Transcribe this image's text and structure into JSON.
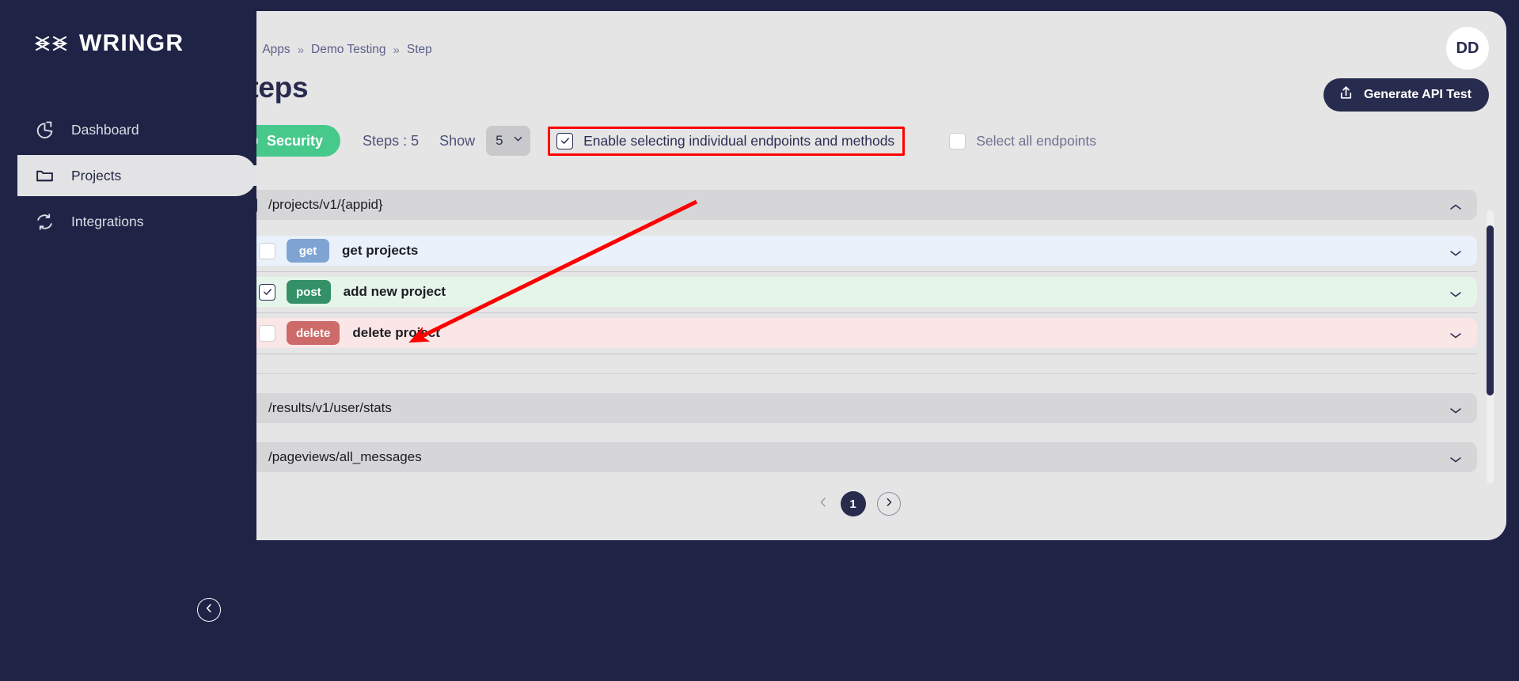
{
  "brand": {
    "name": "WRINGR",
    "logo_icon": "wringr-logo-icon"
  },
  "sidebar": {
    "items": [
      {
        "label": "Dashboard",
        "icon": "pie-chart-icon",
        "active": false
      },
      {
        "label": "Projects",
        "icon": "folder-icon",
        "active": true
      },
      {
        "label": "Integrations",
        "icon": "sync-refresh-icon",
        "active": false
      }
    ],
    "collapse_icon": "chevron-left-circle-icon"
  },
  "header": {
    "breadcrumb": {
      "home_icon": "home-icon",
      "separator": "»",
      "items": [
        "Apps",
        "Demo Testing",
        "Step"
      ]
    },
    "title": "Steps",
    "avatar_initials": "DD",
    "generate_button": {
      "label": "Generate API Test",
      "icon": "upload-share-icon"
    }
  },
  "toolbar": {
    "security_pill": {
      "label": "Security",
      "icon": "lock-icon",
      "color": "#48c98c"
    },
    "steps_count_label": "Steps : 5",
    "show_label": "Show",
    "show_select": {
      "value": "5",
      "icon": "chevron-down-icon"
    },
    "enable_individual": {
      "label": "Enable selecting individual endpoints and methods",
      "checked": true,
      "highlight_color": "#ff0000"
    },
    "select_all": {
      "label": "Select all endpoints",
      "checked": false
    }
  },
  "endpoints": [
    {
      "path": "/projects/v1/{appid}",
      "checked": true,
      "expanded": true,
      "chevron": "chevron-up-icon",
      "methods": [
        {
          "method": "get",
          "name": "get projects",
          "checked": false,
          "color": "#7fa4d3",
          "row_bg": "#eaf1fb",
          "chevron": "chevron-down-icon"
        },
        {
          "method": "post",
          "name": "add new project",
          "checked": true,
          "color": "#349167",
          "row_bg": "#e5f5ea",
          "chevron": "chevron-down-icon"
        },
        {
          "method": "delete",
          "name": "delete project",
          "checked": false,
          "color": "#cd6a6a",
          "row_bg": "#fae6e6",
          "chevron": "chevron-down-icon"
        }
      ]
    },
    {
      "path": "/results/v1/user/stats",
      "checked": false,
      "expanded": false,
      "chevron": "chevron-down-icon",
      "methods": []
    },
    {
      "path": "/pageviews/all_messages",
      "checked": false,
      "expanded": false,
      "chevron": "chevron-down-icon",
      "methods": []
    }
  ],
  "pagination": {
    "prev_icon": "chevron-left-icon",
    "current_page": "1",
    "next_icon": "chevron-right-icon"
  },
  "colors": {
    "sidebar_bg": "#1f2447",
    "panel_bg": "#e5e5e6",
    "accent_dark": "#272b4d",
    "accent_green": "#48c98c",
    "annotation_red": "#ff0000"
  }
}
